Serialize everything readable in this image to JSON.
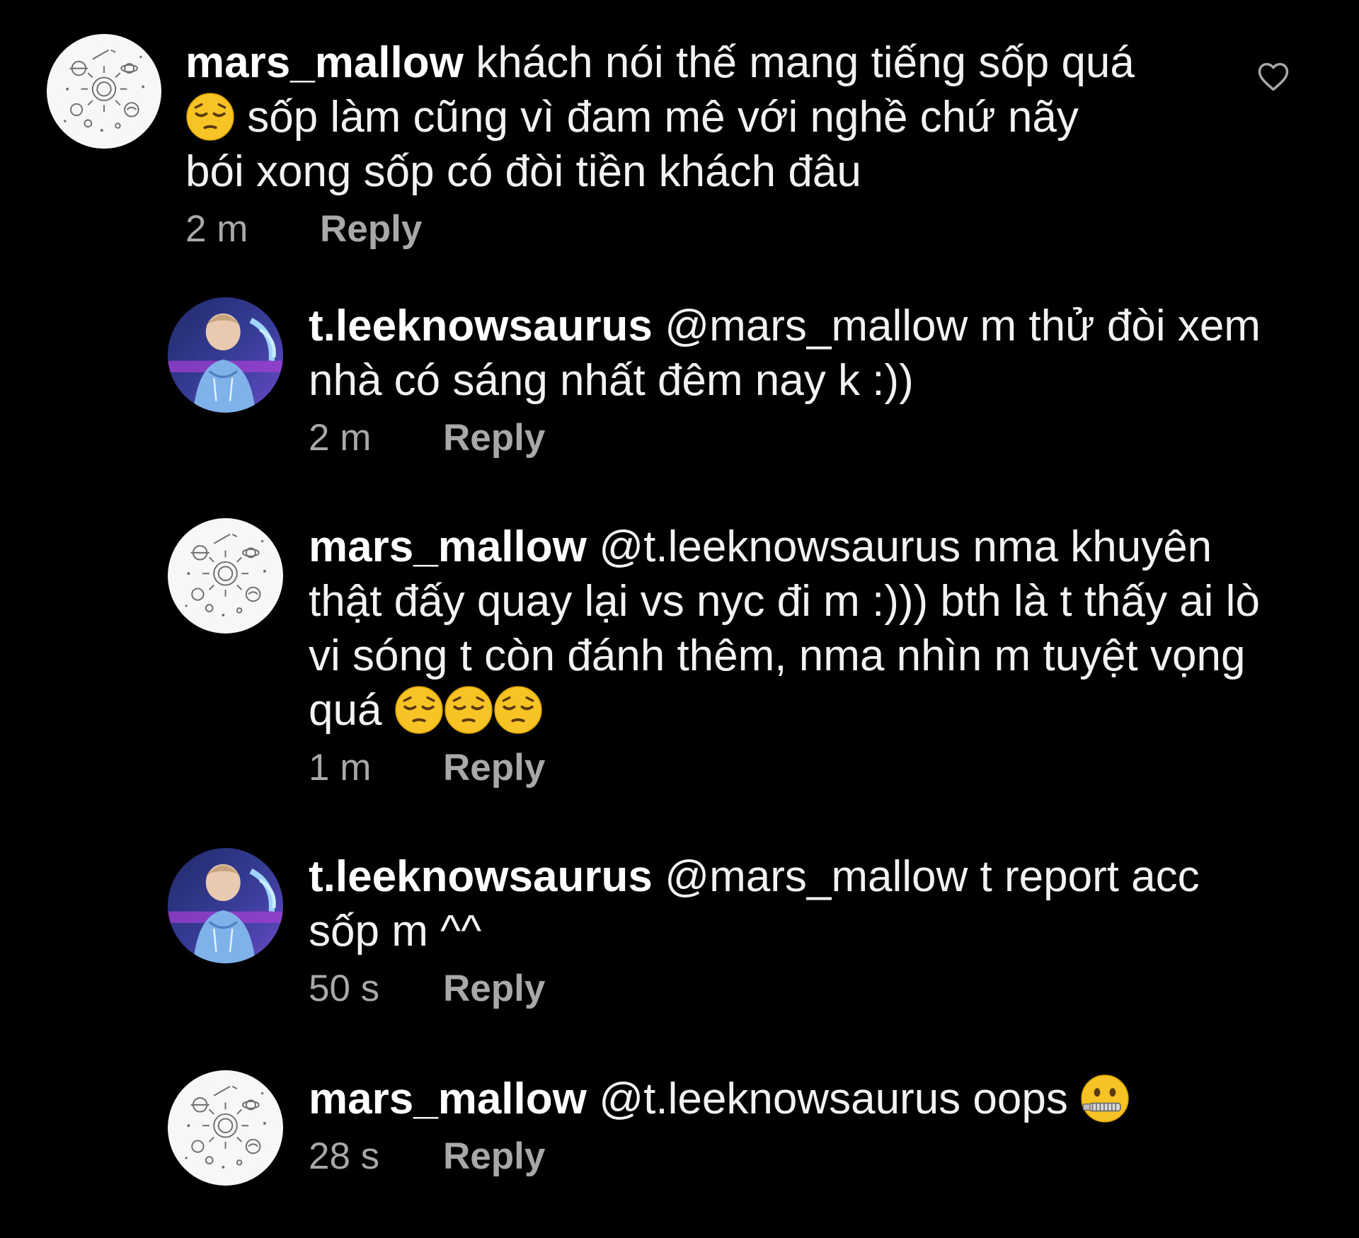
{
  "comments": [
    {
      "username": "mars_mallow",
      "time": "2 m",
      "reply_label": "Reply",
      "line1": "khách nói thế mang tiếng sốp quá",
      "line2": "sốp làm cũng vì đam mê với nghề chứ nãy",
      "line3": "bói xong sốp có đòi tiền khách đâu",
      "emoji": "pensive-face"
    },
    {
      "username": "t.leeknowsaurus",
      "time": "2 m",
      "reply_label": "Reply",
      "line1": "@mars_mallow m thử đòi xem",
      "line2": "nhà có sáng nhất đêm nay k :))"
    },
    {
      "username": "mars_mallow",
      "time": "1 m",
      "reply_label": "Reply",
      "line1": "@t.leeknowsaurus nma khuyên",
      "line2": "thật đấy quay lại vs nyc đi m :))) bth là t thấy ai lò",
      "line3": "vi sóng t còn đánh thêm, nma nhìn m tuyệt vọng",
      "line4": "quá",
      "emoji": "pensive-face"
    },
    {
      "username": "t.leeknowsaurus",
      "time": "50 s",
      "reply_label": "Reply",
      "line1": "@mars_mallow t report acc",
      "line2": "sốp m ^^"
    },
    {
      "username": "mars_mallow",
      "time": "28 s",
      "reply_label": "Reply",
      "line1": "@t.leeknowsaurus oops",
      "emoji": "zipper-mouth-face"
    }
  ],
  "colors": {
    "background": "#000000",
    "text": "#f2f2f2",
    "muted": "#a8a8a8",
    "emoji_yellow": "#f7c325"
  },
  "icons": {
    "like": "heart-outline-icon"
  }
}
